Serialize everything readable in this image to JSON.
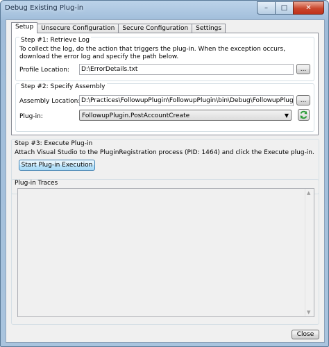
{
  "window": {
    "title": "Debug Existing Plug-in",
    "minimize_glyph": "–",
    "maximize_glyph": "□",
    "close_glyph": "✕"
  },
  "tabs": [
    {
      "label": "Setup",
      "active": true
    },
    {
      "label": "Unsecure Configuration",
      "active": false
    },
    {
      "label": "Secure Configuration",
      "active": false
    },
    {
      "label": "Settings",
      "active": false
    }
  ],
  "step1": {
    "title": "Step #1: Retrieve Log",
    "description": "To collect the log, do the action that triggers the plug-in. When the exception occurs, download the error log and specify the path below.",
    "profile_label": "Profile Location:",
    "profile_value": "D:\\ErrorDetails.txt",
    "browse_label": "..."
  },
  "step2": {
    "title": "Step #2: Specify Assembly",
    "assembly_label": "Assembly Location:",
    "assembly_value": "D:\\Practices\\FollowupPlugin\\FollowupPlugin\\bin\\Debug\\FollowupPlugin.dll",
    "browse_label": "...",
    "plugin_label": "Plug-in:",
    "plugin_value": "FollowupPlugin.PostAccountCreate"
  },
  "step3": {
    "title": "Step #3: Execute Plug-in",
    "description": "Attach Visual Studio to the PluginRegistration process (PID: 1464) and click the Execute plug-in.",
    "start_button": "Start Plug-in Execution"
  },
  "traces": {
    "title": "Plug-in Traces"
  },
  "footer": {
    "close_button": "Close"
  },
  "colors": {
    "title_bar": "#a9c4de",
    "close_button": "#c9462c",
    "start_button": "#bee6fd",
    "refresh_icon": "#2e9d3a"
  },
  "icons": [
    "refresh-icon",
    "combo-arrow-icon",
    "scroll-up-icon",
    "scroll-down-icon"
  ]
}
